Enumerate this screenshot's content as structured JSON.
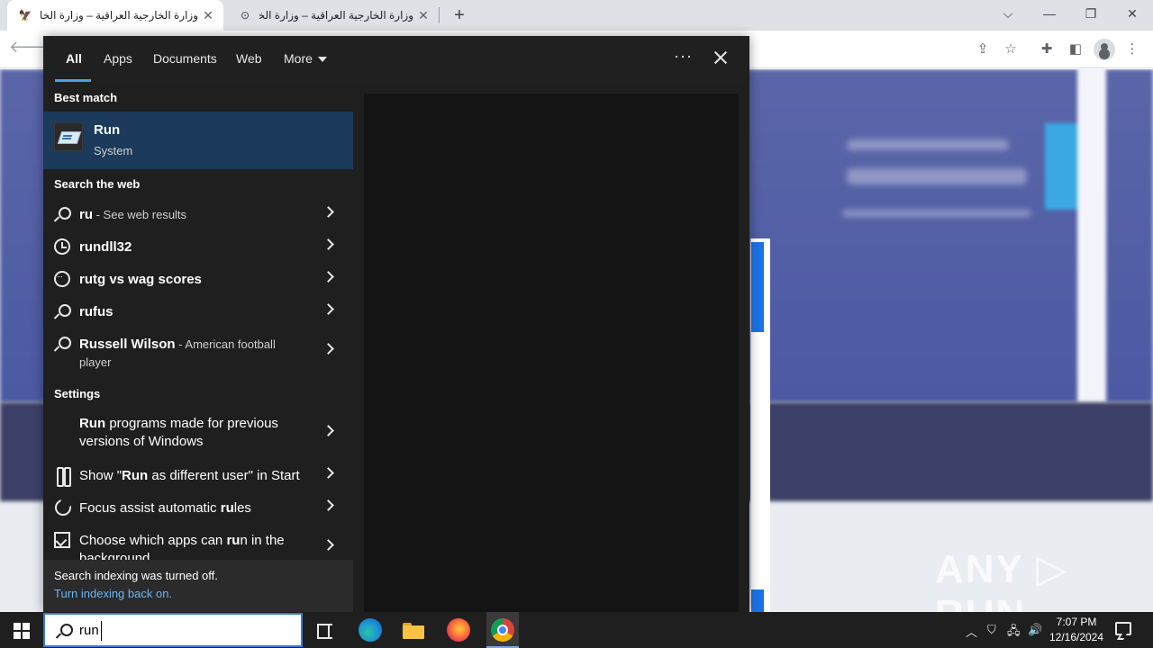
{
  "browser": {
    "tabs": [
      {
        "title": "وزارة الخارجية العراقية – وزارة الخارج",
        "active": true
      },
      {
        "title": "وزارة الخارجية العراقية – وزارة الخار",
        "active": false
      }
    ],
    "new_tab": "+",
    "window_controls": {
      "dropdown": "⌵",
      "minimize": "—",
      "restore": "❐",
      "close": "✕"
    }
  },
  "watermark": "ANY ▷ RUN",
  "search": {
    "tabs": [
      {
        "label": "All"
      },
      {
        "label": "Apps"
      },
      {
        "label": "Documents"
      },
      {
        "label": "Web"
      },
      {
        "label": "More"
      }
    ],
    "more_options": "···",
    "best_match_title": "Best match",
    "best_match": {
      "name": "Run",
      "subtitle": "System"
    },
    "search_web_title": "Search the web",
    "web_results": [
      {
        "text": "ru",
        "suffix": " - See web results"
      },
      {
        "text": "rundll32",
        "suffix": ""
      },
      {
        "text": "rutg vs wag scores",
        "suffix": ""
      },
      {
        "text": "rufus",
        "suffix": ""
      },
      {
        "text": "Russell Wilson",
        "suffix": " - American football",
        "line2": "player"
      }
    ],
    "settings_title": "Settings",
    "settings_results": [
      {
        "bold": "Run",
        "rest": " programs made for previous",
        "line2": "versions of Windows"
      },
      {
        "pre": "Show \"",
        "bold": "Run",
        "rest": " as different user\" in Start"
      },
      {
        "pre": "Focus assist automatic ",
        "bold": "ru",
        "rest": "les"
      },
      {
        "pre": "Choose which apps can ",
        "bold": "ru",
        "rest": "n in the",
        "line2": "background"
      }
    ],
    "footer": {
      "line1": "Search indexing was turned off.",
      "link": "Turn indexing back on."
    }
  },
  "taskbar": {
    "search_query": "run",
    "clock_time": "7:07 PM",
    "clock_date": "12/16/2024"
  }
}
